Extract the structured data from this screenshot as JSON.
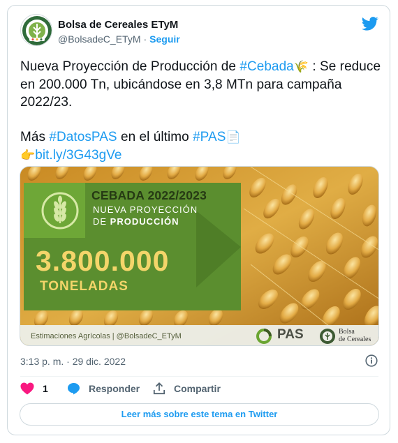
{
  "author": {
    "name": "Bolsa de Cereales ETyM",
    "handle": "@BolsadeC_ETyM",
    "separator": "·",
    "follow_label": "Seguir"
  },
  "tweet": {
    "line1_text": "Nueva Proyección de Producción de ",
    "line1_hashtag": "#Cebada",
    "line1_emoji": "🌾",
    "line1_rest": " : Se reduce en 200.000 Tn, ubicándose en 3,8 MTn para campaña 2022/23.",
    "line2_text": "Más ",
    "line2_hashtag1": "#DatosPAS",
    "line2_mid": " en el último ",
    "line2_hashtag2": "#PAS",
    "line2_emoji": "📄",
    "line3_emoji": "👉",
    "line3_link": "bit.ly/3G43gVe"
  },
  "media": {
    "title": "CEBADA 2022/2023",
    "subtitle1": "NUEVA PROYECCIÓN",
    "subtitle2_pre": "DE ",
    "subtitle2_bold": "PRODUCCIÓN",
    "number": "3.800.000",
    "unit": "TONELADAS",
    "footer_text": "Estimaciones Agrícolas | @BolsadeC_ETyM",
    "pas_label": "PAS",
    "bolsa_line1": "Bolsa",
    "bolsa_line2": "de Cereales"
  },
  "meta": {
    "timestamp": "3:13 p. m. · 29 dic. 2022"
  },
  "actions": {
    "like_count": "1",
    "reply_label": "Responder",
    "share_label": "Compartir"
  },
  "read_more_label": "Leer más sobre este tema en Twitter",
  "colors": {
    "accent": "#1d9bf0",
    "like": "#f91880",
    "panel_green": "#5b8e2f",
    "number_yellow": "#f4d56a"
  },
  "icons": {
    "brand": "twitter-bird-icon",
    "like": "heart-icon",
    "reply": "speech-bubble-icon",
    "share": "share-upload-icon",
    "info": "info-icon"
  }
}
